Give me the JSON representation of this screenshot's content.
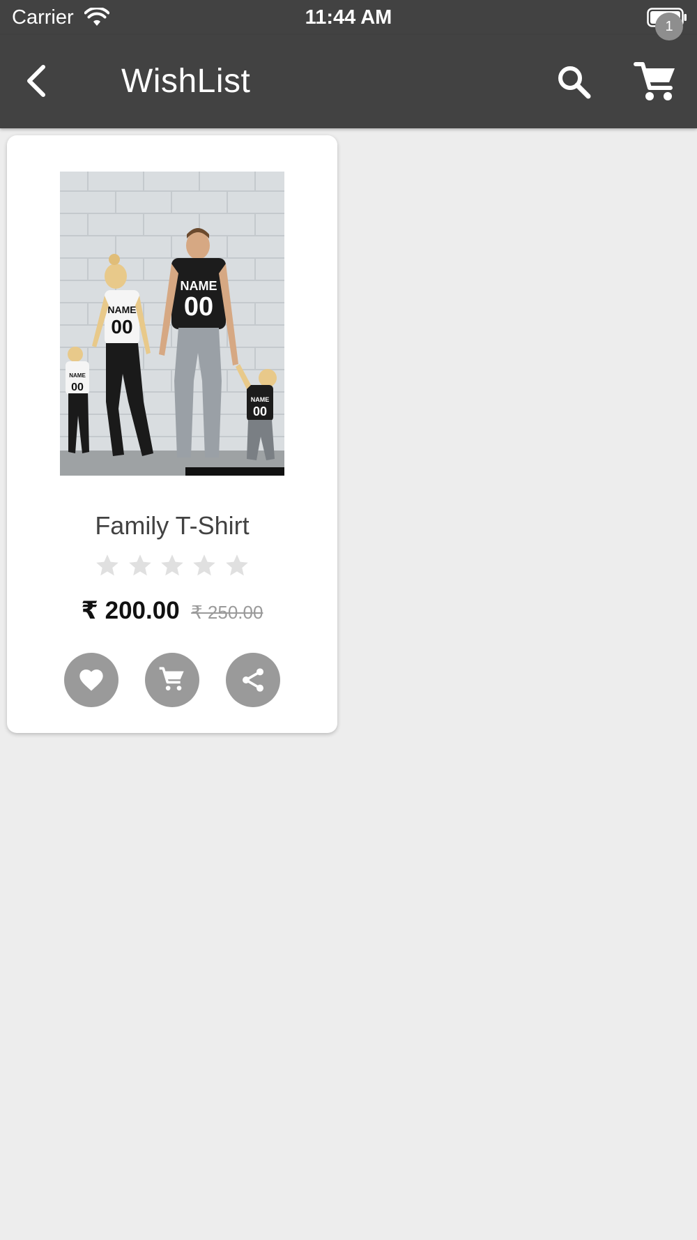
{
  "status_bar": {
    "carrier": "Carrier",
    "time": "11:44 AM",
    "wifi_icon": "wifi-icon",
    "battery_icon": "battery-icon"
  },
  "app_bar": {
    "title": "WishList",
    "back_icon": "chevron-left-icon",
    "search_icon": "search-icon",
    "cart_icon": "cart-icon",
    "cart_badge_count": "1",
    "background_color": "#424242"
  },
  "products": [
    {
      "name": "Family T-Shirt",
      "image_alt": "Family wearing matching NAME 00 t-shirts",
      "rating": 0,
      "rating_max": 5,
      "price": "₹ 200.00",
      "original_price": "₹ 250.00",
      "actions": [
        {
          "icon": "heart-icon"
        },
        {
          "icon": "cart-icon"
        },
        {
          "icon": "share-icon"
        }
      ]
    }
  ],
  "colors": {
    "screen_background": "#ededed",
    "card_background": "#ffffff",
    "action_button": "#9a9a9a",
    "star_empty": "#e0e0e0"
  }
}
